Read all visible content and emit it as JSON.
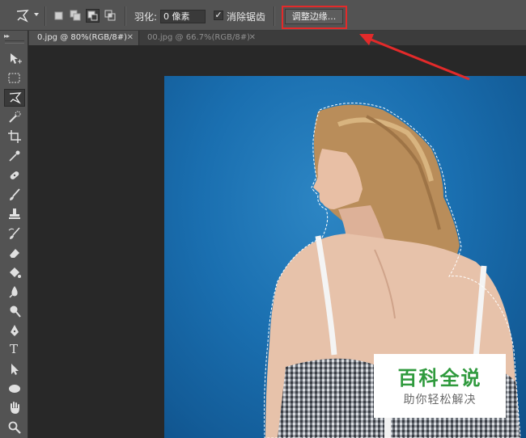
{
  "options_bar": {
    "feather_label": "羽化:",
    "feather_value": "0 像素",
    "antialias_label": "消除锯齿",
    "antialias_checked": true,
    "refine_edge_label": "调整边缘..."
  },
  "tabs": [
    {
      "label": "0.jpg @ 80%(RGB/8#)",
      "active": true
    },
    {
      "label": "00.jpg @ 66.7%(RGB/8#)",
      "active": false
    }
  ],
  "toolbar": {
    "grip": "▸▸",
    "tools": [
      "move-tool-icon",
      "marquee-tool-icon",
      "polygonal-lasso-tool-icon",
      "quick-selection-tool-icon",
      "crop-tool-icon",
      "eyedropper-tool-icon",
      "spot-healing-tool-icon",
      "brush-tool-icon",
      "clone-stamp-tool-icon",
      "history-brush-tool-icon",
      "eraser-tool-icon",
      "paint-bucket-tool-icon",
      "blur-tool-icon",
      "dodge-tool-icon",
      "pen-tool-icon",
      "type-tool-icon",
      "path-selection-tool-icon",
      "ellipse-tool-icon",
      "hand-tool-icon",
      "zoom-tool-icon"
    ],
    "type_tool_letter": "T"
  },
  "watermark": {
    "title": "百科全说",
    "subtitle": "助你轻松解决"
  },
  "colors": {
    "highlight": "#e32a2a",
    "photo_background": "#1a6fb0",
    "watermark_green": "#2f9a3d"
  }
}
